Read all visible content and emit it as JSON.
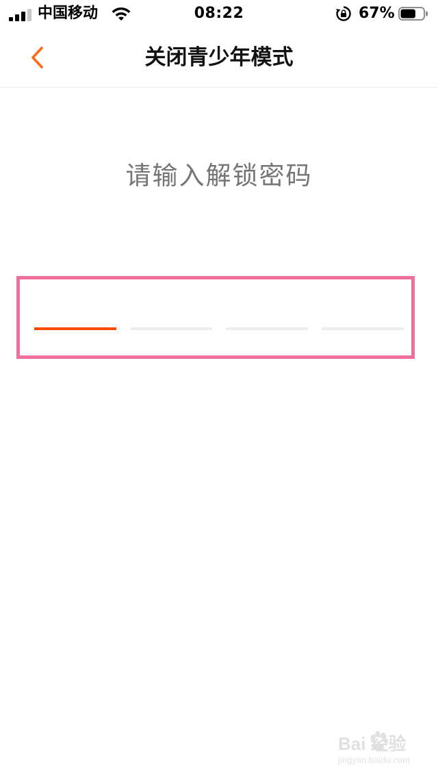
{
  "status_bar": {
    "carrier": "中国移动",
    "time": "08:22",
    "battery_percent": "67%",
    "battery_level": 0.67,
    "signal_bars_active": 3,
    "signal_bars_total": 4,
    "icons": {
      "signal": "cellular-signal-icon",
      "wifi": "wifi-icon",
      "rotation_lock": "rotation-lock-icon",
      "battery": "battery-icon"
    }
  },
  "nav": {
    "back_icon": "chevron-left-icon",
    "title": "关闭青少年模式"
  },
  "prompt": "请输入解锁密码",
  "passcode": {
    "length": 4,
    "entered": 0,
    "active_index": 0
  },
  "watermark": {
    "logo": "Bai 经验",
    "paw_icon": "baidu-paw-icon",
    "url": "jingyan.baidu.com"
  },
  "colors": {
    "accent": "#ff4a00",
    "back_arrow": "#ff6a13",
    "inactive_slot": "#ececec",
    "prompt_text": "#757575",
    "highlight_frame": "#f06f9a",
    "signal_inactive": "#c7c7c7"
  }
}
